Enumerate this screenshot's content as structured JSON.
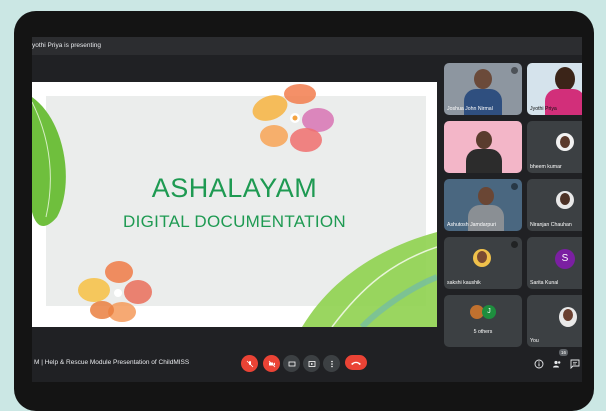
{
  "presenter_bar": {
    "text": "yothi Priya is presenting"
  },
  "slide": {
    "title": "ASHALAYAM",
    "subtitle": "DIGITAL DOCUMENTATION"
  },
  "participants": [
    {
      "name": "Joshua John Nirmal"
    },
    {
      "name": "Jyothi Priya"
    },
    {
      "name": ""
    },
    {
      "name": "bheem kumar"
    },
    {
      "name": "Ashutosh Jamdarpuri"
    },
    {
      "name": "Niranjan Chauhan"
    },
    {
      "name": "sakshi kaushik"
    },
    {
      "name": "Sarita Kunal",
      "initial": "S",
      "color": "#7b1fa2"
    },
    {
      "name": "5 others",
      "initial": "J",
      "color": "#1e8e3e"
    },
    {
      "name": "You"
    }
  ],
  "bottom_bar": {
    "meeting_title": "M  |  Help & Rescue Module Presentation of ChildMISS",
    "people_count": "16"
  },
  "colors": {
    "accent_red": "#ea4335",
    "slide_green": "#1e9a52",
    "bg": "#202124"
  }
}
